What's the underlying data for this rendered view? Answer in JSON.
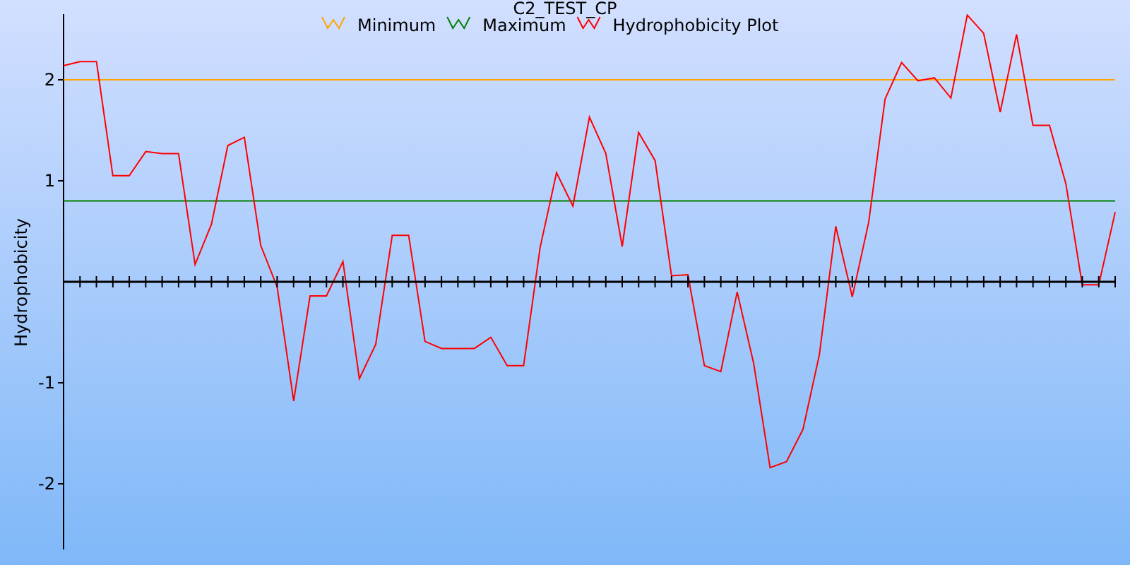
{
  "chart_data": {
    "type": "line",
    "title": "C2_TEST_CP",
    "ylabel": "Hydrophobicity",
    "legend": true,
    "ylim": [
      -2.65,
      2.65
    ],
    "yticks": [
      -2,
      -1,
      1,
      2
    ],
    "series": [
      {
        "name": "Minimum",
        "color": "#ffa500",
        "values": [
          2,
          2,
          2,
          2,
          2,
          2,
          2,
          2,
          2,
          2,
          2,
          2,
          2,
          2,
          2,
          2,
          2,
          2,
          2,
          2,
          2,
          2,
          2,
          2,
          2,
          2,
          2,
          2,
          2,
          2,
          2,
          2,
          2,
          2,
          2,
          2,
          2,
          2,
          2,
          2,
          2,
          2,
          2,
          2,
          2,
          2,
          2,
          2,
          2,
          2,
          2,
          2,
          2,
          2,
          2,
          2,
          2,
          2,
          2,
          2,
          2,
          2,
          2,
          2,
          2
        ]
      },
      {
        "name": "Maximum",
        "color": "#008000",
        "values": [
          0.8,
          0.8,
          0.8,
          0.8,
          0.8,
          0.8,
          0.8,
          0.8,
          0.8,
          0.8,
          0.8,
          0.8,
          0.8,
          0.8,
          0.8,
          0.8,
          0.8,
          0.8,
          0.8,
          0.8,
          0.8,
          0.8,
          0.8,
          0.8,
          0.8,
          0.8,
          0.8,
          0.8,
          0.8,
          0.8,
          0.8,
          0.8,
          0.8,
          0.8,
          0.8,
          0.8,
          0.8,
          0.8,
          0.8,
          0.8,
          0.8,
          0.8,
          0.8,
          0.8,
          0.8,
          0.8,
          0.8,
          0.8,
          0.8,
          0.8,
          0.8,
          0.8,
          0.8,
          0.8,
          0.8,
          0.8,
          0.8,
          0.8,
          0.8,
          0.8,
          0.8,
          0.8,
          0.8,
          0.8,
          0.8
        ]
      },
      {
        "name": "Hydrophobicity Plot",
        "color": "#ff0000",
        "values": [
          2.14,
          2.18,
          2.18,
          1.05,
          1.05,
          1.29,
          1.27,
          1.27,
          0.17,
          0.57,
          1.35,
          1.43,
          0.36,
          -0.05,
          -1.18,
          -0.14,
          -0.14,
          0.2,
          -0.96,
          -0.62,
          0.46,
          0.46,
          -0.59,
          -0.66,
          -0.66,
          -0.66,
          -0.55,
          -0.83,
          -0.83,
          0.34,
          1.08,
          0.75,
          1.63,
          1.27,
          0.35,
          1.48,
          1.2,
          0.06,
          0.07,
          -0.83,
          -0.89,
          -0.1,
          -0.81,
          -1.84,
          -1.78,
          -1.46,
          -0.72,
          0.55,
          -0.15,
          0.59,
          1.81,
          2.17,
          1.99,
          2.02,
          1.82,
          2.64,
          2.46,
          1.68,
          2.45,
          1.55,
          1.55,
          0.97,
          -0.03,
          -0.03,
          0.69
        ]
      }
    ]
  }
}
